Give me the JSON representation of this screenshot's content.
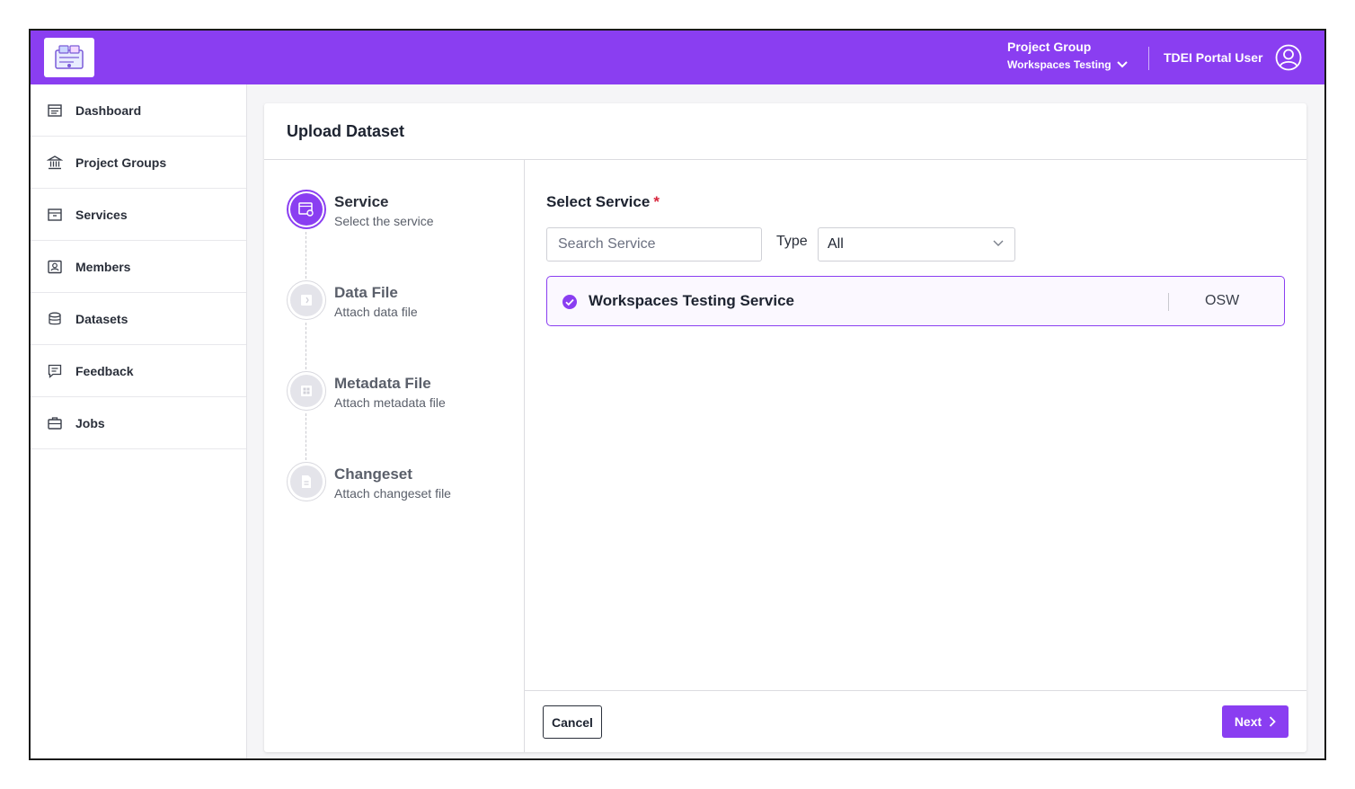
{
  "header": {
    "project_group_label": "Project Group",
    "project_group_value": "Workspaces Testing",
    "user_name": "TDEI Portal User",
    "accent_color": "#8a3ef1"
  },
  "sidebar": {
    "items": [
      {
        "label": "Dashboard",
        "icon": "dashboard-icon"
      },
      {
        "label": "Project Groups",
        "icon": "bank-icon"
      },
      {
        "label": "Services",
        "icon": "archive-icon"
      },
      {
        "label": "Members",
        "icon": "member-icon"
      },
      {
        "label": "Datasets",
        "icon": "database-icon"
      },
      {
        "label": "Feedback",
        "icon": "feedback-icon"
      },
      {
        "label": "Jobs",
        "icon": "briefcase-icon"
      }
    ]
  },
  "main": {
    "title": "Upload Dataset",
    "steps": [
      {
        "title": "Service",
        "desc": "Select the service",
        "icon": "service-icon",
        "active": true
      },
      {
        "title": "Data File",
        "desc": "Attach data file",
        "icon": "data-file-icon",
        "active": false
      },
      {
        "title": "Metadata File",
        "desc": "Attach metadata file",
        "icon": "metadata-icon",
        "active": false
      },
      {
        "title": "Changeset",
        "desc": "Attach changeset file",
        "icon": "changeset-icon",
        "active": false
      }
    ],
    "select_service_label": "Select Service",
    "required_mark": "*",
    "search_placeholder": "Search Service",
    "type_label": "Type",
    "type_value": "All",
    "services": [
      {
        "name": "Workspaces Testing Service",
        "type": "OSW",
        "selected": true
      }
    ],
    "cancel_label": "Cancel",
    "next_label": "Next"
  }
}
